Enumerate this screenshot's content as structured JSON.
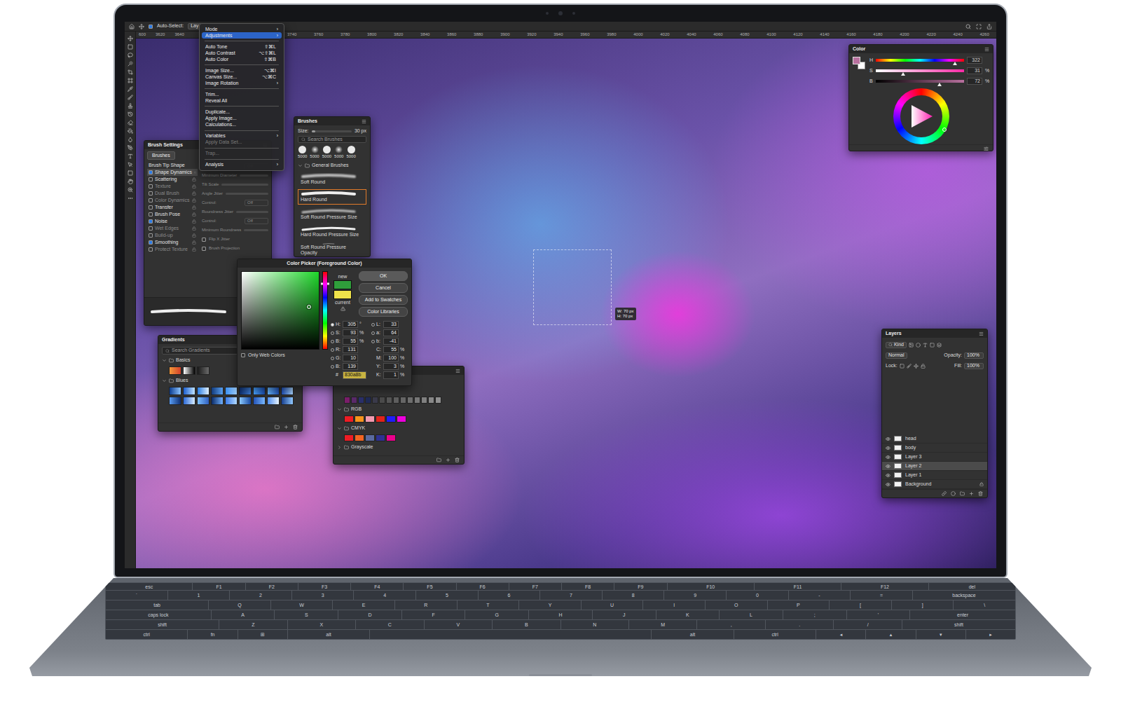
{
  "option_bar": {
    "auto_select": {
      "label": "Auto-Select:",
      "checked": true
    },
    "target": "Lay"
  },
  "ruler": {
    "left": [
      "600",
      "3620",
      "3640"
    ],
    "right": [
      "3740",
      "3760",
      "3780",
      "3800",
      "3820",
      "3840",
      "3860",
      "3880",
      "3900",
      "3920",
      "3940",
      "3960",
      "3980",
      "4000",
      "4020",
      "4040",
      "4060",
      "4080",
      "4100",
      "4120",
      "4140",
      "4160",
      "4180",
      "4200",
      "4220",
      "4240",
      "4260"
    ]
  },
  "image_menu": [
    {
      "kind": "item",
      "label": "Mode",
      "shortcut": "",
      "submenu": "›",
      "disabled": false,
      "selected": false
    },
    {
      "kind": "item",
      "label": "Adjustments",
      "shortcut": "",
      "submenu": "›",
      "disabled": false,
      "selected": true
    },
    {
      "kind": "separator",
      "label": "",
      "shortcut": "",
      "submenu": "",
      "disabled": false,
      "selected": false
    },
    {
      "kind": "item",
      "label": "Auto Tone",
      "shortcut": "⇧⌘L",
      "submenu": "",
      "disabled": false,
      "selected": false
    },
    {
      "kind": "item",
      "label": "Auto Contrast",
      "shortcut": "⌥⇧⌘L",
      "submenu": "",
      "disabled": false,
      "selected": false
    },
    {
      "kind": "item",
      "label": "Auto Color",
      "shortcut": "⇧⌘B",
      "submenu": "",
      "disabled": false,
      "selected": false
    },
    {
      "kind": "separator",
      "label": "",
      "shortcut": "",
      "submenu": "",
      "disabled": false,
      "selected": false
    },
    {
      "kind": "item",
      "label": "Image Size...",
      "shortcut": "⌥⌘I",
      "submenu": "",
      "disabled": false,
      "selected": false
    },
    {
      "kind": "item",
      "label": "Canvas Size...",
      "shortcut": "⌥⌘C",
      "submenu": "",
      "disabled": false,
      "selected": false
    },
    {
      "kind": "item",
      "label": "Image Rotation",
      "shortcut": "",
      "submenu": "›",
      "disabled": false,
      "selected": false
    },
    {
      "kind": "separator",
      "label": "",
      "shortcut": "",
      "submenu": "",
      "disabled": false,
      "selected": false
    },
    {
      "kind": "item",
      "label": "Trim...",
      "shortcut": "",
      "submenu": "",
      "disabled": false,
      "selected": false
    },
    {
      "kind": "item",
      "label": "Reveal All",
      "shortcut": "",
      "submenu": "",
      "disabled": false,
      "selected": false
    },
    {
      "kind": "separator",
      "label": "",
      "shortcut": "",
      "submenu": "",
      "disabled": false,
      "selected": false
    },
    {
      "kind": "item",
      "label": "Duplicate...",
      "shortcut": "",
      "submenu": "",
      "disabled": false,
      "selected": false
    },
    {
      "kind": "item",
      "label": "Apply Image...",
      "shortcut": "",
      "submenu": "",
      "disabled": false,
      "selected": false
    },
    {
      "kind": "item",
      "label": "Calculations...",
      "shortcut": "",
      "submenu": "",
      "disabled": false,
      "selected": false
    },
    {
      "kind": "separator",
      "label": "",
      "shortcut": "",
      "submenu": "",
      "disabled": false,
      "selected": false
    },
    {
      "kind": "item",
      "label": "Variables",
      "shortcut": "",
      "submenu": "›",
      "disabled": false,
      "selected": false
    },
    {
      "kind": "item",
      "label": "Apply Data Set...",
      "shortcut": "",
      "submenu": "",
      "disabled": true,
      "selected": false
    },
    {
      "kind": "separator",
      "label": "",
      "shortcut": "",
      "submenu": "",
      "disabled": false,
      "selected": false
    },
    {
      "kind": "item",
      "label": "Trap...",
      "shortcut": "",
      "submenu": "",
      "disabled": true,
      "selected": false
    },
    {
      "kind": "separator",
      "label": "",
      "shortcut": "",
      "submenu": "",
      "disabled": false,
      "selected": false
    },
    {
      "kind": "item",
      "label": "Analysis",
      "shortcut": "",
      "submenu": "›",
      "disabled": false,
      "selected": false
    }
  ],
  "brush_settings": {
    "title": "Brush Settings",
    "button": "Brushes",
    "items": [
      {
        "label": "Brush Tip Shape",
        "checkbox": false,
        "checked": false,
        "selected": false,
        "disabled": false,
        "locked": false
      },
      {
        "label": "Shape Dynamics",
        "checkbox": true,
        "checked": true,
        "selected": true,
        "disabled": false,
        "locked": true
      },
      {
        "label": "Scattering",
        "checkbox": true,
        "checked": false,
        "selected": false,
        "disabled": false,
        "locked": true
      },
      {
        "label": "Texture",
        "checkbox": true,
        "checked": false,
        "selected": false,
        "disabled": true,
        "locked": true
      },
      {
        "label": "Dual Brush",
        "checkbox": true,
        "checked": false,
        "selected": false,
        "disabled": true,
        "locked": true
      },
      {
        "label": "Color Dynamics",
        "checkbox": true,
        "checked": false,
        "selected": false,
        "disabled": true,
        "locked": true
      },
      {
        "label": "Transfer",
        "checkbox": true,
        "checked": false,
        "selected": false,
        "disabled": false,
        "locked": true
      },
      {
        "label": "Brush Pose",
        "checkbox": true,
        "checked": false,
        "selected": false,
        "disabled": false,
        "locked": true
      },
      {
        "label": "Noise",
        "checkbox": true,
        "checked": true,
        "selected": false,
        "disabled": false,
        "locked": true
      },
      {
        "label": "Wet Edges",
        "checkbox": true,
        "checked": false,
        "selected": false,
        "disabled": true,
        "locked": true
      },
      {
        "label": "Build-up",
        "checkbox": true,
        "checked": false,
        "selected": false,
        "disabled": true,
        "locked": true
      },
      {
        "label": "Smoothing",
        "checkbox": true,
        "checked": true,
        "selected": false,
        "disabled": false,
        "locked": true
      },
      {
        "label": "Protect Texture",
        "checkbox": true,
        "checked": false,
        "selected": false,
        "disabled": true,
        "locked": true
      }
    ],
    "controls": [
      {
        "kind": "dropdown",
        "label": "Control:",
        "value": "Off",
        "level": 0,
        "checked": false
      },
      {
        "kind": "slider",
        "label": "Minimum Diameter",
        "value": "",
        "level": 0,
        "checked": false
      },
      {
        "kind": "slider",
        "label": "Tilt Scale",
        "value": "",
        "level": 0,
        "checked": false
      },
      {
        "kind": "slider",
        "label": "Angle Jitter",
        "value": "",
        "level": 0,
        "checked": false
      },
      {
        "kind": "dropdown",
        "label": "Control:",
        "value": "Off",
        "level": 0,
        "checked": false
      },
      {
        "kind": "slider",
        "label": "Roundness Jitter",
        "value": "",
        "level": 0,
        "checked": false
      },
      {
        "kind": "dropdown",
        "label": "Control:",
        "value": "Off",
        "level": 0,
        "checked": false
      },
      {
        "kind": "slider",
        "label": "Minimum Roundness",
        "value": "",
        "level": 0,
        "checked": false
      },
      {
        "kind": "checkbox",
        "label": "Flip X Jitter",
        "value": "",
        "level": 0,
        "checked": false
      },
      {
        "kind": "checkbox",
        "label": "Brush Projection",
        "value": "",
        "level": 0,
        "checked": false
      }
    ]
  },
  "brushes": {
    "title": "Brushes",
    "size_label": "Size:",
    "size_value": "30 px",
    "size_level": 0.1,
    "search_placeholder": "Search Brushes",
    "presets": [
      {
        "label": "5000",
        "kind": "hard"
      },
      {
        "label": "5000",
        "kind": "soft"
      },
      {
        "label": "5000",
        "kind": "hard"
      },
      {
        "label": "5000",
        "kind": "soft"
      },
      {
        "label": "5000",
        "kind": "hard"
      }
    ],
    "folder": {
      "label": "General Brushes",
      "expanded": true
    },
    "items": [
      {
        "label": "Soft Round",
        "kind": "soft",
        "selected": false
      },
      {
        "label": "Hard Round",
        "kind": "hard",
        "selected": true
      },
      {
        "label": "Soft Round Pressure Size",
        "kind": "soft-taper",
        "selected": false
      },
      {
        "label": "Hard Round Pressure Size",
        "kind": "hard-taper",
        "selected": false
      },
      {
        "label": "Soft Round Pressure Opacity",
        "kind": "soft-fade",
        "selected": false
      }
    ]
  },
  "color_picker": {
    "title": "Color Picker (Foreground Color)",
    "buttons": [
      "OK",
      "Cancel",
      "Add to Swatches",
      "Color Libraries"
    ],
    "swatches": [
      {
        "label": "new",
        "color": "#2f9e3b"
      },
      {
        "label": "current",
        "color": "#efe24a"
      }
    ],
    "marker": {
      "x": 0.87,
      "y": 0.45
    },
    "hue_level": 0.85,
    "web_colors": {
      "label": "Only Web Colors",
      "checked": false
    },
    "fields_left": [
      {
        "label": "H:",
        "value": "305",
        "unit": "°",
        "radio": true,
        "selected": true
      },
      {
        "label": "S:",
        "value": "93",
        "unit": "%",
        "radio": true,
        "selected": false
      },
      {
        "label": "B:",
        "value": "55",
        "unit": "%",
        "radio": true,
        "selected": false
      },
      {
        "label": "R:",
        "value": "131",
        "unit": "",
        "radio": true,
        "selected": false
      },
      {
        "label": "G:",
        "value": "10",
        "unit": "",
        "radio": true,
        "selected": false
      },
      {
        "label": "B:",
        "value": "139",
        "unit": "",
        "radio": true,
        "selected": false
      }
    ],
    "fields_right": [
      {
        "label": "L:",
        "value": "33",
        "unit": "",
        "radio": true,
        "selected": false
      },
      {
        "label": "a:",
        "value": "64",
        "unit": "",
        "radio": true,
        "selected": false
      },
      {
        "label": "b:",
        "value": "-41",
        "unit": "",
        "radio": true,
        "selected": false
      },
      {
        "label": "C:",
        "value": "55",
        "unit": "%",
        "radio": false,
        "selected": false
      },
      {
        "label": "M:",
        "value": "100",
        "unit": "%",
        "radio": false,
        "selected": false
      },
      {
        "label": "Y:",
        "value": "3",
        "unit": "%",
        "radio": false,
        "selected": false
      },
      {
        "label": "K:",
        "value": "1",
        "unit": "%",
        "radio": false,
        "selected": false
      }
    ],
    "hex": {
      "label": "#",
      "value": "830a8b",
      "selected": true
    }
  },
  "gradients": {
    "title": "Gradients",
    "search_placeholder": "Search Gradients",
    "groups": [
      {
        "label": "Basics",
        "expanded": true,
        "swatches": [
          {
            "color": "#f39a3a",
            "color2": "#d2402a"
          },
          {
            "color": "#ffffff",
            "color2": "#000000"
          },
          {
            "color": "#1a1a1a",
            "color2": "#6a6a6a"
          }
        ]
      },
      {
        "label": "Blues",
        "expanded": true,
        "swatches": [
          {
            "color": "#0b3d91",
            "color2": "#8ec5ff"
          },
          {
            "color": "#1c5fd0",
            "color2": "#bfe3ff"
          },
          {
            "color": "#2a7de1",
            "color2": "#e0f0ff"
          },
          {
            "color": "#123a7a",
            "color2": "#5aa0f0"
          },
          {
            "color": "#3b8ff0",
            "color2": "#9fd0ff"
          },
          {
            "color": "#0e2f6e",
            "color2": "#3f7fd8"
          },
          {
            "color": "#4aa3ff",
            "color2": "#1a4aa8"
          },
          {
            "color": "#6ab8ff",
            "color2": "#2050b0"
          },
          {
            "color": "#1d4fb8",
            "color2": "#a8d4ff"
          },
          {
            "color": "#5a9ef5",
            "color2": "#0d2e70"
          },
          {
            "color": "#2c6ad8",
            "color2": "#d6ecff"
          },
          {
            "color": "#7cc0ff",
            "color2": "#3060c0"
          },
          {
            "color": "#0a2a66",
            "color2": "#6fb0ff"
          },
          {
            "color": "#3a7ae8",
            "color2": "#b0d8ff"
          },
          {
            "color": "#8ccaff",
            "color2": "#1848a0"
          },
          {
            "color": "#2454b8",
            "color2": "#78b8ff"
          },
          {
            "color": "#4d8ef0",
            "color2": "#e8f4ff"
          },
          {
            "color": "#163e8e",
            "color2": "#90c8ff"
          }
        ]
      }
    ]
  },
  "swatches": {
    "recent": [
      "#7a1d6a",
      "#5a2a6a",
      "#2a2f6a",
      "#1f2a55",
      "#3a3a4a",
      "#4a4a4a",
      "#555555",
      "#5e5e5e",
      "#666666",
      "#6e6e6e",
      "#777777",
      "#808080",
      "#888888",
      "#909090"
    ],
    "groups": [
      {
        "label": "RGB",
        "expanded": true,
        "colors": [
          "#ed1c24",
          "#f7941d",
          "#f29bb0",
          "#e2231a",
          "#1e1eff",
          "#ec00dc"
        ]
      },
      {
        "label": "CMYK",
        "expanded": true,
        "colors": [
          "#ed1c24",
          "#f26522",
          "#5a6aa0",
          "#2e3192",
          "#ec008c"
        ]
      },
      {
        "label": "Grayscale",
        "expanded": false,
        "colors": []
      }
    ]
  },
  "color_panel": {
    "title": "Color",
    "foreground": "#b8709e",
    "background": "#ffffff",
    "channels": [
      {
        "label": "H",
        "kind": "hue",
        "value": "322",
        "unit": "",
        "level": 0.9
      },
      {
        "label": "S",
        "kind": "saturation",
        "value": "31",
        "unit": "%",
        "level": 0.31
      },
      {
        "label": "B",
        "kind": "brightness",
        "value": "72",
        "unit": "%",
        "level": 0.72
      }
    ]
  },
  "layers": {
    "title": "Layers",
    "filter": "Kind",
    "blend_mode": "Normal",
    "opacity_label": "Opacity:",
    "opacity": "100%",
    "lock_label": "Lock:",
    "fill_label": "Fill:",
    "fill": "100%",
    "items": [
      {
        "name": "head",
        "visible": true,
        "selected": false,
        "locked": false
      },
      {
        "name": "body",
        "visible": true,
        "selected": false,
        "locked": false
      },
      {
        "name": "Layer 3",
        "visible": true,
        "selected": false,
        "locked": false
      },
      {
        "name": "Layer 2",
        "visible": true,
        "selected": true,
        "locked": false
      },
      {
        "name": "Layer 1",
        "visible": true,
        "selected": false,
        "locked": false
      },
      {
        "name": "Background",
        "visible": true,
        "selected": false,
        "locked": true
      }
    ]
  },
  "transform_tooltip": [
    "W: 70 px",
    "H: 70 px"
  ],
  "keyboard": {
    "rows": [
      [
        "esc",
        "F1",
        "F2",
        "F3",
        "F4",
        "F5",
        "F6",
        "F7",
        "F8",
        "F9",
        "F10",
        "F11",
        "F12",
        "del"
      ],
      [
        "`",
        "1",
        "2",
        "3",
        "4",
        "5",
        "6",
        "7",
        "8",
        "9",
        "0",
        "-",
        "=",
        "backspace"
      ],
      [
        "tab",
        "Q",
        "W",
        "E",
        "R",
        "T",
        "Y",
        "U",
        "I",
        "O",
        "P",
        "[",
        "]",
        "\\"
      ],
      [
        "caps lock",
        "A",
        "S",
        "D",
        "F",
        "G",
        "H",
        "J",
        "K",
        "L",
        ";",
        "'",
        "enter"
      ],
      [
        "shift",
        "Z",
        "X",
        "C",
        "V",
        "B",
        "N",
        "M",
        ",",
        ".",
        "/",
        "shift"
      ],
      [
        "ctrl",
        "fn",
        "⊞",
        "alt",
        " ",
        "alt",
        "ctrl",
        "◂",
        "▴",
        "▾",
        "▸"
      ]
    ]
  }
}
